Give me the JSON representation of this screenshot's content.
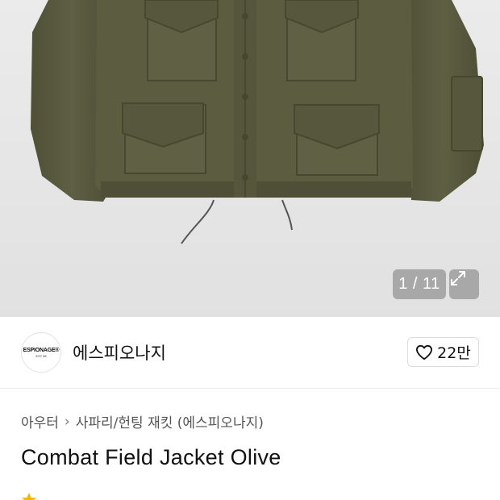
{
  "gallery": {
    "counter_text": "1 / 11",
    "expand_icon": "expand-icon"
  },
  "brand": {
    "logo_text_line1": "ESPIONAGE®",
    "logo_text_line2": "EST 98",
    "name": "에스피오나지",
    "like_icon": "heart-icon",
    "like_count": "22만"
  },
  "breadcrumb": {
    "category": "아우터",
    "subcategory": "사파리/헌팅 재킷 (에스피오나지)"
  },
  "product": {
    "title": "Combat Field Jacket Olive"
  },
  "colors": {
    "jacket_olive": "#5a5a3f",
    "background_gray": "#e6e6e6",
    "rating_star": "#f5b800"
  }
}
